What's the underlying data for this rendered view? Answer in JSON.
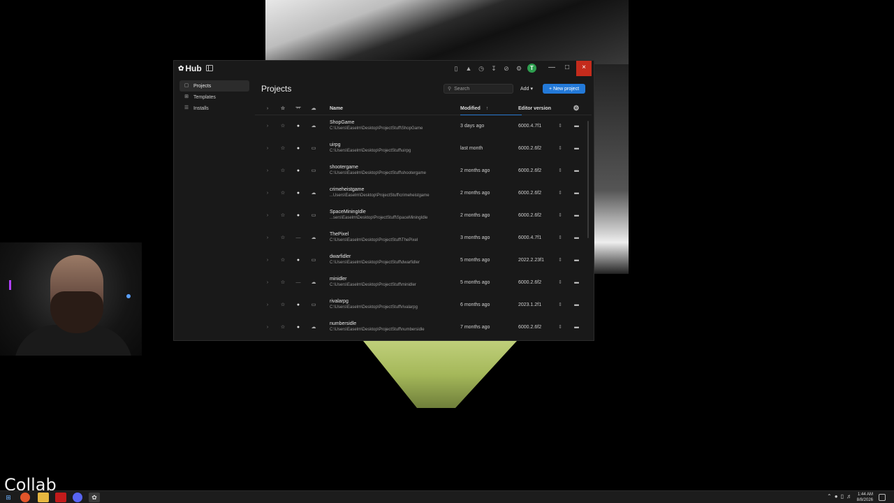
{
  "window": {
    "app_name": "Hub",
    "avatar_initial": "T",
    "close_glyph": "×",
    "min_glyph": "—",
    "max_glyph": "□"
  },
  "sidebar": {
    "items": [
      {
        "label": "Projects",
        "icon": "folder-icon",
        "glyph": "▢"
      },
      {
        "label": "Templates",
        "icon": "templates-icon",
        "glyph": "⊞"
      },
      {
        "label": "Installs",
        "icon": "installs-icon",
        "glyph": "☰"
      }
    ]
  },
  "main": {
    "title": "Projects",
    "search_placeholder": "Search",
    "add_label": "Add",
    "add_caret": "▾",
    "new_project_label": "New project",
    "new_project_icon": "+"
  },
  "table": {
    "headers": {
      "name": "Name",
      "modified": "Modified",
      "modified_sort": "↑",
      "editor_version": "Editor version"
    },
    "rows": [
      {
        "name": "ShopGame",
        "path": "C:\\Users\\Easelm\\Desktop\\ProjectStuff\\ShopGame",
        "modified": "3 days ago",
        "version": "6000.4.7f1",
        "git": true,
        "cloud": "cloud"
      },
      {
        "name": "uirpg",
        "path": "C:\\Users\\Easelm\\Desktop\\ProjectStuff\\uirpg",
        "modified": "last month",
        "version": "6000.2.6f2",
        "git": true,
        "cloud": "local"
      },
      {
        "name": "shootergame",
        "path": "C:\\Users\\Easelm\\Desktop\\ProjectStuff\\shootergame",
        "modified": "2 months ago",
        "version": "6000.2.6f2",
        "git": true,
        "cloud": "local"
      },
      {
        "name": "crimeheistgame",
        "path": "...Users\\Easelm\\Desktop\\ProjectStuff\\crimeheistgame",
        "modified": "2 months ago",
        "version": "6000.2.6f2",
        "git": true,
        "cloud": "cloud"
      },
      {
        "name": "SpaceMiningIdle",
        "path": "...sers\\Easelm\\Desktop\\ProjectStuff\\SpaceMiningIdle",
        "modified": "2 months ago",
        "version": "6000.2.6f2",
        "git": true,
        "cloud": "local"
      },
      {
        "name": "ThePixel",
        "path": "C:\\Users\\Easelm\\Desktop\\ProjectStuff\\ThePixel",
        "modified": "3 months ago",
        "version": "6000.4.7f1",
        "git": false,
        "cloud": "cloud"
      },
      {
        "name": "dwarfidler",
        "path": "C:\\Users\\Easelm\\Desktop\\ProjectStuff\\dwarfidler",
        "modified": "5 months ago",
        "version": "2022.2.23f1",
        "git": true,
        "cloud": "local"
      },
      {
        "name": "minidler",
        "path": "C:\\Users\\Easelm\\Desktop\\ProjectStuff\\minidler",
        "modified": "5 months ago",
        "version": "6000.2.6f2",
        "git": false,
        "cloud": "cloud"
      },
      {
        "name": "rivalarpg",
        "path": "C:\\Users\\Easelm\\Desktop\\ProjectStuff\\rivalarpg",
        "modified": "6 months ago",
        "version": "2023.1.2f1",
        "git": true,
        "cloud": "local"
      },
      {
        "name": "numbersidle",
        "path": "C:\\Users\\Easelm\\Desktop\\ProjectStuff\\numbersidle",
        "modified": "7 months ago",
        "version": "6000.2.6f2",
        "git": true,
        "cloud": "cloud"
      }
    ]
  },
  "overlay": {
    "text": "Collab"
  },
  "taskbar": {
    "time": "1:44 AM",
    "date": "8/8/2026"
  },
  "colors": {
    "accent": "#2379d8",
    "close": "#c42b1c",
    "avatar": "#2e9e4f"
  }
}
